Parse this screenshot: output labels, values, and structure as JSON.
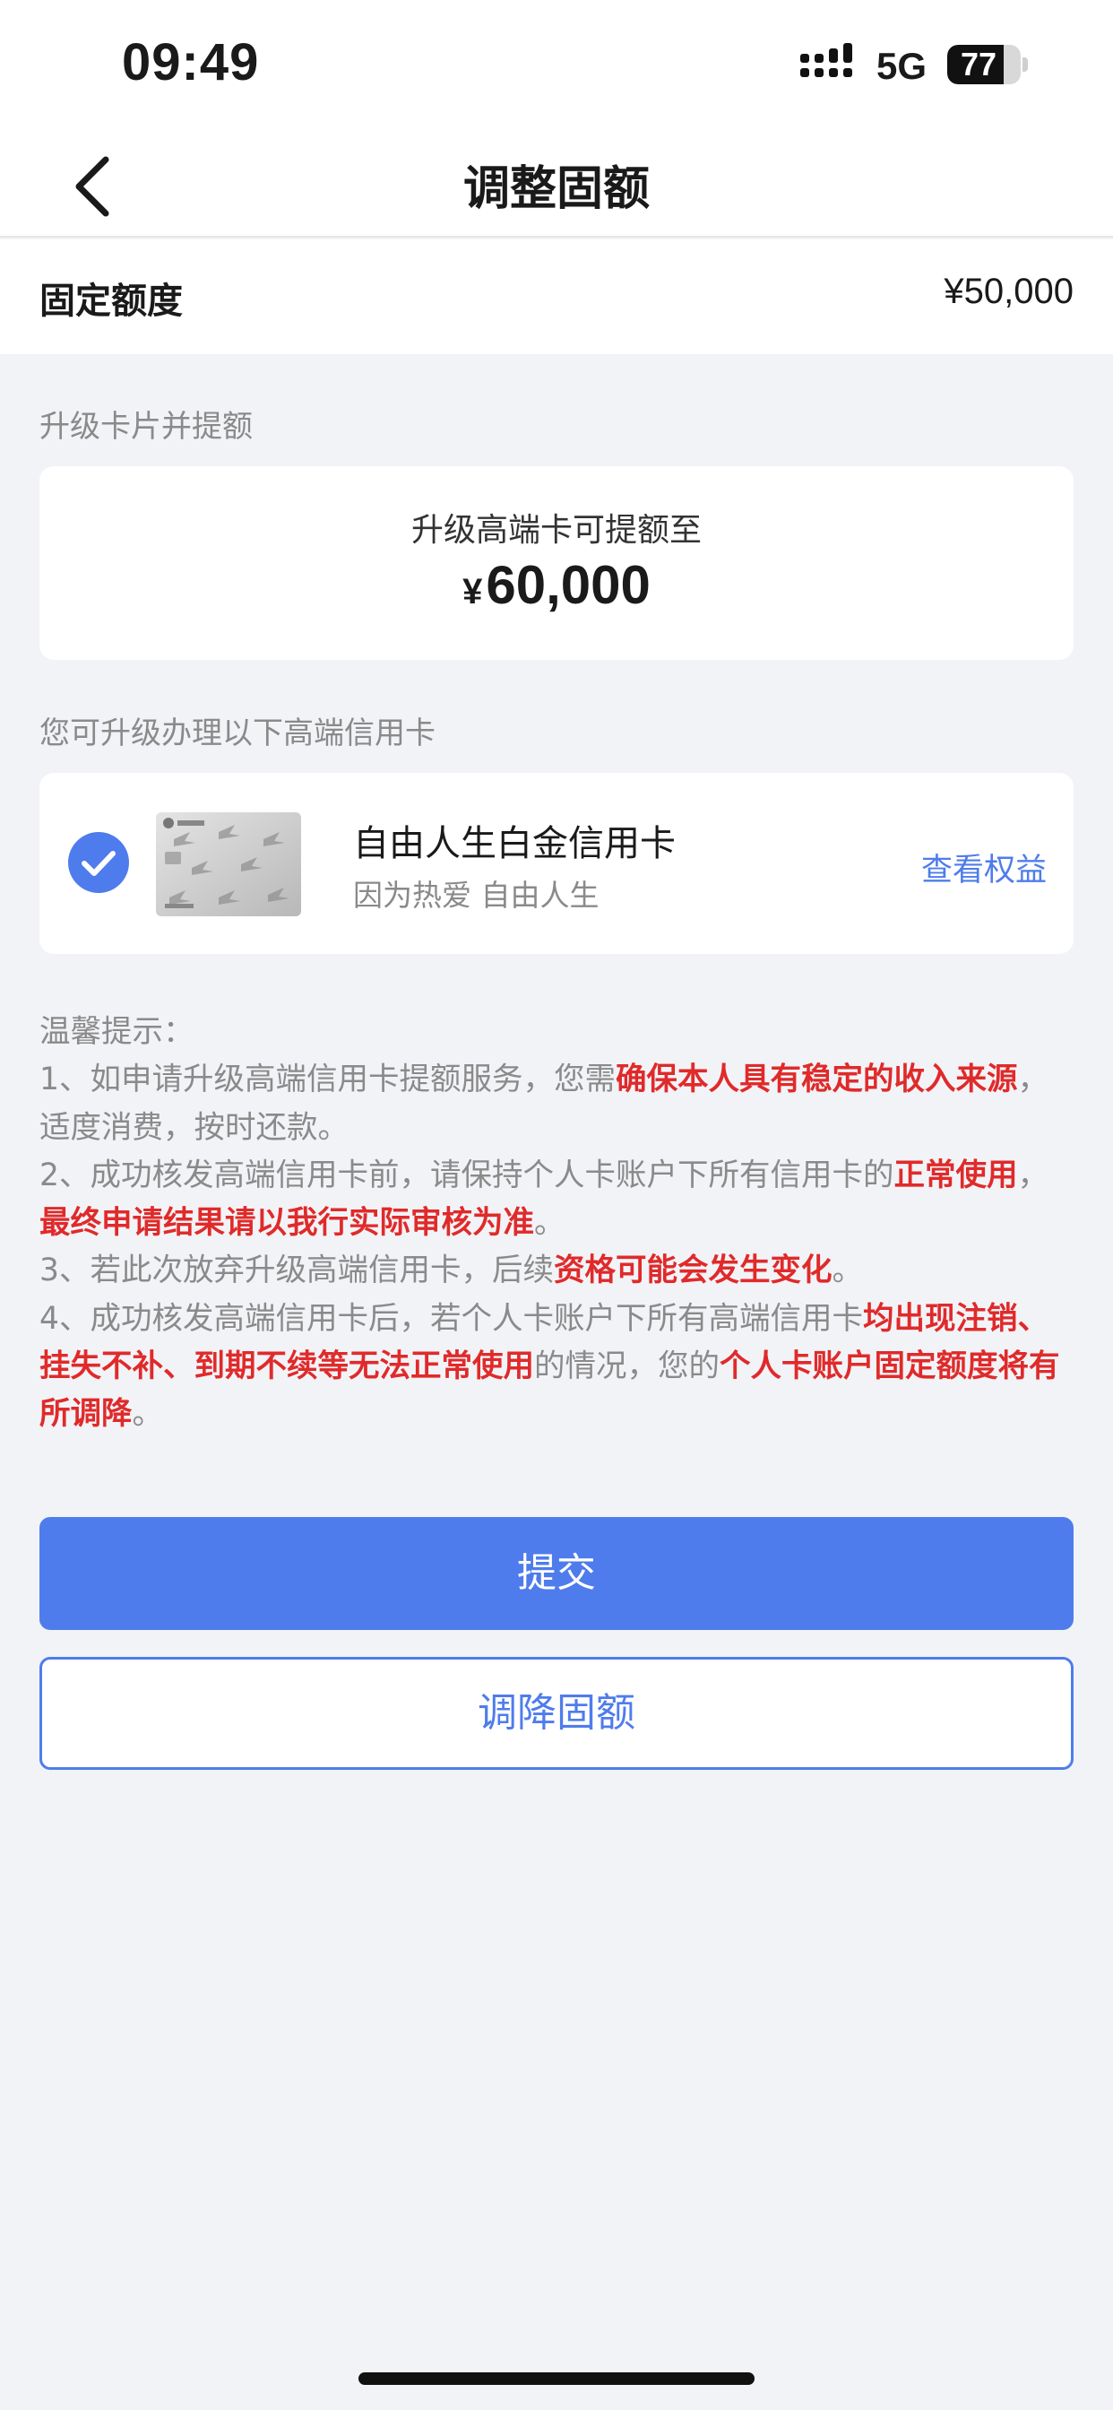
{
  "status_bar": {
    "time": "09:49",
    "network": "5G",
    "battery_level": "77",
    "battery_fraction": 0.77
  },
  "nav": {
    "title": "调整固额",
    "back_icon": "chevron-left-icon"
  },
  "fixed_limit": {
    "label": "固定额度",
    "value": "¥50,000"
  },
  "upgrade_section": {
    "label": "升级卡片并提额",
    "caption": "升级高端卡可提额至",
    "currency": "¥",
    "amount": "60,000"
  },
  "card_section": {
    "label": "您可升级办理以下高端信用卡",
    "card": {
      "selected": true,
      "name": "自由人生白金信用卡",
      "slogan": "因为热爱 自由人生",
      "benefit_link": "查看权益"
    }
  },
  "tips": {
    "title": "温馨提示：",
    "items": [
      [
        {
          "text": "1、如申请升级高端信用卡提额服务，您需",
          "red": false
        },
        {
          "text": "确保本人具有稳定的收入来源",
          "red": true
        },
        {
          "text": "，适度消费，按时还款。",
          "red": false
        }
      ],
      [
        {
          "text": "2、成功核发高端信用卡前，请保持个人卡账户下所有信用卡的",
          "red": false
        },
        {
          "text": "正常使用",
          "red": true
        },
        {
          "text": "，",
          "red": false
        },
        {
          "text": "最终申请结果请以我行实际审核为准",
          "red": true
        },
        {
          "text": "。",
          "red": false
        }
      ],
      [
        {
          "text": "3、若此次放弃升级高端信用卡，后续",
          "red": false
        },
        {
          "text": "资格可能会发生变化",
          "red": true
        },
        {
          "text": "。",
          "red": false
        }
      ],
      [
        {
          "text": "4、成功核发高端信用卡后，若个人卡账户下所有高端信用卡",
          "red": false
        },
        {
          "text": "均出现注销、挂失不补、到期不续等无法正常使用",
          "red": true
        },
        {
          "text": "的情况，您的",
          "red": false
        },
        {
          "text": "个人卡账户固定额度将有所调降",
          "red": true
        },
        {
          "text": "。",
          "red": false
        }
      ]
    ]
  },
  "buttons": {
    "submit": "提交",
    "reduce": "调降固额"
  },
  "colors": {
    "accent": "#4f7cec",
    "warning_red": "#e02a2a",
    "background": "#f2f3f7"
  }
}
